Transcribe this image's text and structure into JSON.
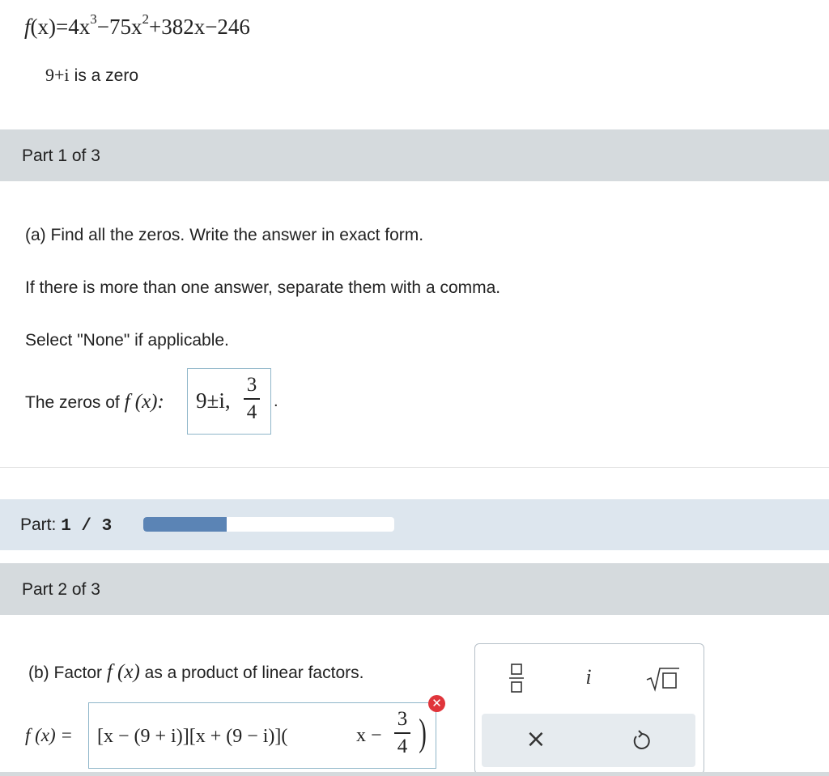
{
  "problem": {
    "function_parts": [
      "f",
      "(x)=4x",
      "3",
      "−75x",
      "2",
      "+382x−246"
    ],
    "zero_value": "9+i",
    "zero_text": "is a zero"
  },
  "part1": {
    "header": "Part 1 of 3",
    "instruction1": "(a) Find all the zeros. Write the answer in exact form.",
    "instruction2": "If there is more than one answer, separate them with a comma.",
    "instruction3": "Select \"None\" if applicable.",
    "answer_label_prefix": "The zeros of ",
    "answer_label_fx": "f (x):",
    "answer_main": "9±i,",
    "answer_frac_num": "3",
    "answer_frac_den": "4",
    "answer_suffix": "."
  },
  "progress": {
    "label": "Part:",
    "value_text": "1 / 3",
    "fraction": 0.333
  },
  "part2": {
    "header": "Part 2 of 3",
    "instruction_prefix": "(b) Factor ",
    "instruction_fx": "f (x)",
    "instruction_suffix": " as a product of linear factors.",
    "lhs": "f (x) =",
    "expr_main": "[x − (9 + i)][x + (9 − i)](",
    "expr_x": "x −",
    "frac_num": "3",
    "frac_den": "4",
    "expr_close": ")",
    "error_symbol": "✕"
  },
  "palette": {
    "fraction_icon": "fraction-icon",
    "imag_label": "i",
    "sqrt_icon": "sqrt-icon",
    "clear_symbol": "×",
    "undo_symbol": "↺"
  },
  "colors": {
    "band": "#d5dadd",
    "progress_band": "#dde6ee",
    "progress_fill": "#5b84b5",
    "input_border": "#8fb6c9",
    "error": "#e0353b"
  }
}
